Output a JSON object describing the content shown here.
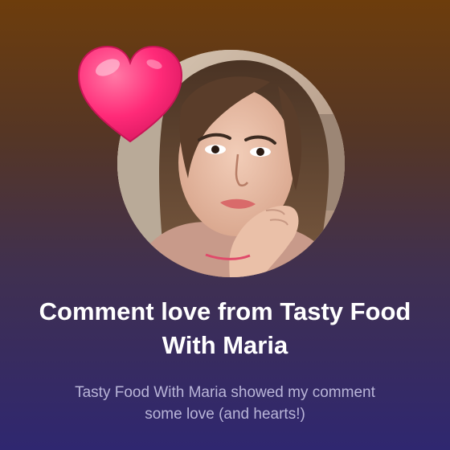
{
  "card": {
    "title": "Comment love from Tasty Food With Maria",
    "subtitle": "Tasty Food With Maria showed my comment some love (and hearts!)"
  },
  "colors": {
    "title_text": "#ffffff",
    "subtitle_text": "#b9b5d8",
    "heart": "#ff2a78",
    "background_top": "#6d3d0c",
    "background_bottom": "#2f2770"
  },
  "icons": {
    "heart": "heart-icon",
    "avatar": "creator-avatar"
  }
}
